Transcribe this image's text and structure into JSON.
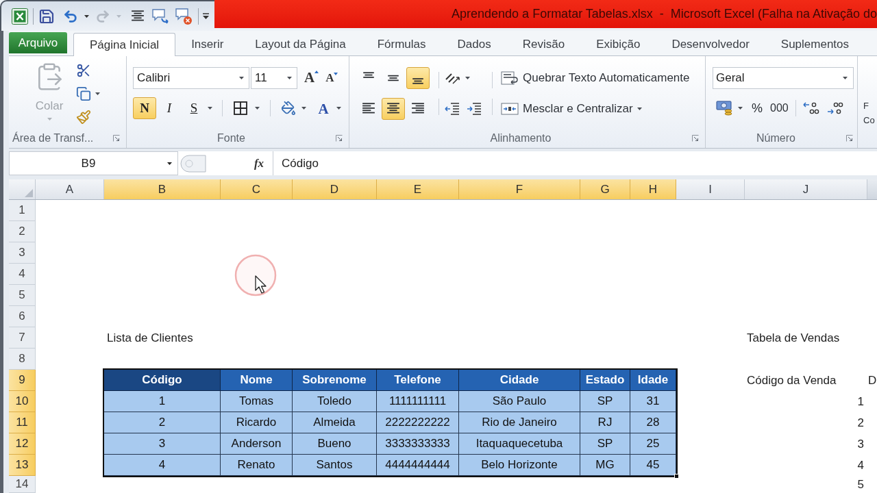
{
  "window": {
    "title": "Aprendendo a Formatar Tabelas.xlsx  -  Microsoft Excel (Falha na Ativação do"
  },
  "ribbon_tabs": [
    {
      "label": "Arquivo",
      "kind": "file",
      "selected": false
    },
    {
      "label": "Página Inicial",
      "kind": "tab",
      "selected": true
    },
    {
      "label": "Inserir",
      "kind": "tab",
      "selected": false
    },
    {
      "label": "Layout da Página",
      "kind": "tab",
      "selected": false
    },
    {
      "label": "Fórmulas",
      "kind": "tab",
      "selected": false
    },
    {
      "label": "Dados",
      "kind": "tab",
      "selected": false
    },
    {
      "label": "Revisão",
      "kind": "tab",
      "selected": false
    },
    {
      "label": "Exibição",
      "kind": "tab",
      "selected": false
    },
    {
      "label": "Desenvolvedor",
      "kind": "tab",
      "selected": false
    },
    {
      "label": "Suplementos",
      "kind": "tab",
      "selected": false
    }
  ],
  "ribbon": {
    "clipboard": {
      "paste_label": "Colar",
      "paste_disabled": true,
      "group_label": "Área de Transf..."
    },
    "font": {
      "font_name": "Calibri",
      "font_size": "11",
      "grow_label": "A",
      "shrink_label": "A",
      "style_buttons": [
        {
          "label": "N",
          "kind": "bold",
          "on": true
        },
        {
          "label": "I",
          "kind": "italic",
          "on": false
        },
        {
          "label": "S",
          "kind": "underline",
          "on": false
        }
      ],
      "font_color_label": "A",
      "group_label": "Fonte"
    },
    "alignment": {
      "buttons": [
        {
          "kind": "top",
          "on": false
        },
        {
          "kind": "middle",
          "on": false
        },
        {
          "kind": "bottom",
          "on": true
        },
        {
          "kind": "left",
          "on": false
        },
        {
          "kind": "center",
          "on": true
        },
        {
          "kind": "right",
          "on": false
        }
      ],
      "wrap_text": "Quebrar Texto Automaticamente",
      "merge_center": "Mesclar e Centralizar",
      "group_label": "Alinhamento"
    },
    "number": {
      "format": "Geral",
      "percent": "%",
      "thousands": "000",
      "group_label": "Número"
    },
    "partial_group": {
      "lines": [
        "F",
        "Co"
      ]
    }
  },
  "formula_bar": {
    "name_box": "B9",
    "function_label": "fx",
    "value": "Código"
  },
  "sheet": {
    "columns": [
      {
        "label": "A",
        "selected": false
      },
      {
        "label": "B",
        "selected": true
      },
      {
        "label": "C",
        "selected": true
      },
      {
        "label": "D",
        "selected": true
      },
      {
        "label": "E",
        "selected": true
      },
      {
        "label": "F",
        "selected": true
      },
      {
        "label": "G",
        "selected": true
      },
      {
        "label": "H",
        "selected": true
      },
      {
        "label": "I",
        "selected": false
      },
      {
        "label": "J",
        "selected": false
      }
    ],
    "rows": [
      {
        "label": "1",
        "selected": false
      },
      {
        "label": "2",
        "selected": false
      },
      {
        "label": "3",
        "selected": false
      },
      {
        "label": "4",
        "selected": false
      },
      {
        "label": "5",
        "selected": false
      },
      {
        "label": "6",
        "selected": false
      },
      {
        "label": "7",
        "selected": false
      },
      {
        "label": "8",
        "selected": false
      },
      {
        "label": "9",
        "selected": true
      },
      {
        "label": "10",
        "selected": true
      },
      {
        "label": "11",
        "selected": true
      },
      {
        "label": "12",
        "selected": true
      },
      {
        "label": "13",
        "selected": true
      },
      {
        "label": "14",
        "selected": false
      }
    ],
    "list_title": "Lista de Clientes",
    "sales_title": "Tabela de Vendas",
    "clients_table": {
      "columns": [
        {
          "label": "Código",
          "active": true
        },
        {
          "label": "Nome",
          "active": false
        },
        {
          "label": "Sobrenome",
          "active": false
        },
        {
          "label": "Telefone",
          "active": false
        },
        {
          "label": "Cidade",
          "active": false
        },
        {
          "label": "Estado",
          "active": false
        },
        {
          "label": "Idade",
          "active": false
        }
      ],
      "rows": [
        [
          "1",
          "Tomas",
          "Toledo",
          "1111111111",
          "São Paulo",
          "SP",
          "31"
        ],
        [
          "2",
          "Ricardo",
          "Almeida",
          "2222222222",
          "Rio de Janeiro",
          "RJ",
          "28"
        ],
        [
          "3",
          "Anderson",
          "Bueno",
          "3333333333",
          "Itaquaquecetuba",
          "SP",
          "25"
        ],
        [
          "4",
          "Renato",
          "Santos",
          "4444444444",
          "Belo Horizonte",
          "MG",
          "45"
        ]
      ]
    },
    "sales_table": {
      "columns": [
        "Código da Venda",
        "D"
      ],
      "codes": [
        "1",
        "2",
        "3",
        "4",
        "5"
      ]
    }
  }
}
